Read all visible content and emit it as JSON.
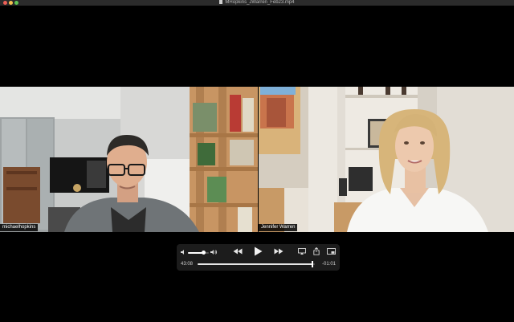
{
  "window": {
    "title": "MHopkins_JWarren_Feb23.mp4"
  },
  "participants": [
    {
      "name_label": "michaelhopkins"
    },
    {
      "name_label": "Jennifer Warren"
    }
  ],
  "player": {
    "elapsed": "43:08",
    "remaining": "-01:01",
    "volume_fraction": 0.75,
    "progress_fraction": 0.977,
    "icons": {
      "volume_low": "speaker-low-icon",
      "volume_high": "speaker-high-icon",
      "rewind": "rewind-icon",
      "play": "play-icon",
      "fast_forward": "fast-forward-icon",
      "airplay": "airplay-icon",
      "share": "share-icon",
      "pip": "picture-in-picture-icon"
    }
  },
  "colors": {
    "background": "#000000",
    "titlebar": "#2b2b2b",
    "controls_bg": "#1c1c1c",
    "close": "#ec5f57",
    "minimize": "#f4bf4f",
    "zoom": "#5fc454"
  }
}
